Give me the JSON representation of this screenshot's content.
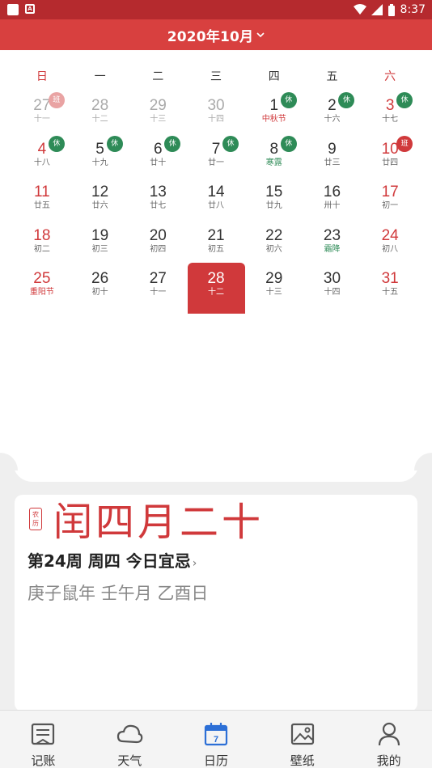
{
  "status": {
    "time": "8:37"
  },
  "header": {
    "title": "2020年10月"
  },
  "weekdays": [
    "日",
    "一",
    "二",
    "三",
    "四",
    "五",
    "六"
  ],
  "calendar": {
    "rows": [
      [
        {
          "d": "27",
          "l": "十一",
          "badge": "班",
          "other": true
        },
        {
          "d": "28",
          "l": "十二",
          "other": true
        },
        {
          "d": "29",
          "l": "十三",
          "other": true
        },
        {
          "d": "30",
          "l": "十四",
          "other": true
        },
        {
          "d": "1",
          "l": "中秋节",
          "badge": "休"
        },
        {
          "d": "2",
          "l": "十六",
          "badge": "休"
        },
        {
          "d": "3",
          "l": "十七",
          "badge": "休"
        }
      ],
      [
        {
          "d": "4",
          "l": "十八",
          "badge": "休"
        },
        {
          "d": "5",
          "l": "十九",
          "badge": "休"
        },
        {
          "d": "6",
          "l": "廿十",
          "badge": "休"
        },
        {
          "d": "7",
          "l": "廿一",
          "badge": "休"
        },
        {
          "d": "8",
          "l": "寒露",
          "badge": "休"
        },
        {
          "d": "9",
          "l": "廿三"
        },
        {
          "d": "10",
          "l": "廿四",
          "badge": "班"
        }
      ],
      [
        {
          "d": "11",
          "l": "廿五"
        },
        {
          "d": "12",
          "l": "廿六"
        },
        {
          "d": "13",
          "l": "廿七"
        },
        {
          "d": "14",
          "l": "廿八"
        },
        {
          "d": "15",
          "l": "廿九"
        },
        {
          "d": "16",
          "l": "卅十"
        },
        {
          "d": "17",
          "l": "初一"
        }
      ],
      [
        {
          "d": "18",
          "l": "初二"
        },
        {
          "d": "19",
          "l": "初三"
        },
        {
          "d": "20",
          "l": "初四"
        },
        {
          "d": "21",
          "l": "初五"
        },
        {
          "d": "22",
          "l": "初六"
        },
        {
          "d": "23",
          "l": "霜降"
        },
        {
          "d": "24",
          "l": "初八"
        }
      ],
      [
        {
          "d": "25",
          "l": "重阳节"
        },
        {
          "d": "26",
          "l": "初十"
        },
        {
          "d": "27",
          "l": "十一"
        },
        {
          "d": "28",
          "l": "十二",
          "today": true
        },
        {
          "d": "29",
          "l": "十三"
        },
        {
          "d": "30",
          "l": "十四"
        },
        {
          "d": "31",
          "l": "十五"
        }
      ]
    ]
  },
  "detail": {
    "seal": "农历",
    "lunar_date": "闰四月二十",
    "week_line": "第24周 周四 今日宜忌",
    "ganzhi": "庚子鼠年 壬午月 乙酉日"
  },
  "tabs": [
    {
      "label": "记账",
      "icon": "ledger-icon"
    },
    {
      "label": "天气",
      "icon": "cloud-icon"
    },
    {
      "label": "日历",
      "icon": "calendar-icon",
      "active": true,
      "day": "7"
    },
    {
      "label": "壁纸",
      "icon": "image-icon"
    },
    {
      "label": "我的",
      "icon": "person-icon"
    }
  ],
  "colors": {
    "status_bar": "#b52a2e",
    "header": "#d8403f",
    "accent_red": "#d0393b",
    "rest_green": "#2e8b57",
    "active_tab": "#2c6fd6"
  }
}
